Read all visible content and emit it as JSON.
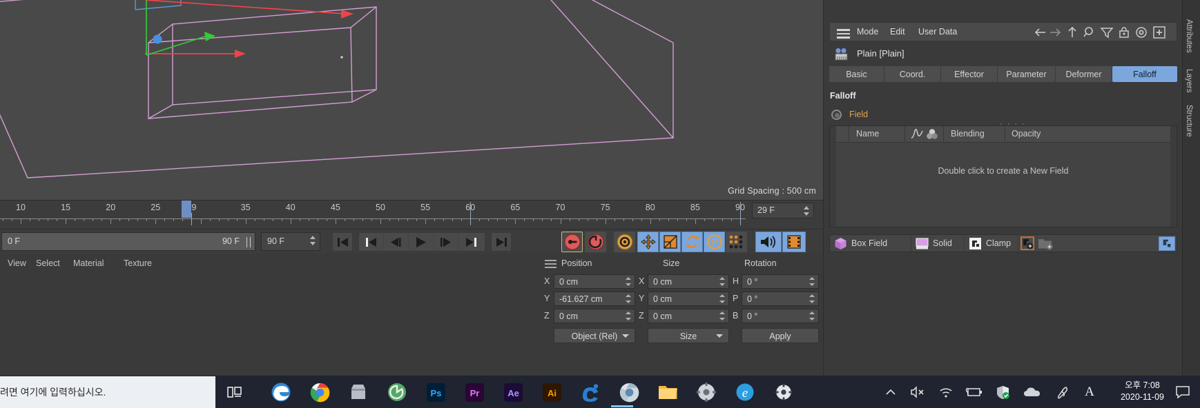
{
  "viewport": {
    "grid_spacing": "Grid Spacing : 500 cm",
    "background": "#494949",
    "wire_color": "#d59fd5",
    "axis_x_color": "#f0444a",
    "axis_y_color": "#38c838",
    "axis_z_color": "#4a90e2"
  },
  "timeline": {
    "labels": [
      "10",
      "15",
      "20",
      "25",
      "29",
      "35",
      "40",
      "45",
      "50",
      "55",
      "60",
      "65",
      "70",
      "75",
      "80",
      "85",
      "90"
    ],
    "playhead_frame": "29",
    "frame_field": "29 F"
  },
  "transport": {
    "range_start": "0 F",
    "range_end": "90 F",
    "end_field": "90 F",
    "buttons": [
      {
        "name": "go-to-start-button",
        "icon": "skip-start"
      },
      {
        "name": "previous-key-button",
        "icon": "prev-key"
      },
      {
        "name": "previous-frame-button",
        "icon": "step-back"
      },
      {
        "name": "play-button",
        "icon": "play"
      },
      {
        "name": "next-frame-button",
        "icon": "step-forward"
      },
      {
        "name": "next-key-button",
        "icon": "next-key"
      },
      {
        "name": "go-to-end-button",
        "icon": "skip-end"
      }
    ],
    "toggles": [
      {
        "name": "record-active-objects-button",
        "icon": "record-key",
        "color": "#e05a5a"
      },
      {
        "name": "autokeying-button",
        "icon": "auto-key",
        "color": "#e05a5a"
      },
      {
        "name": "keyframe-settings-button",
        "icon": "gear",
        "color": "#e0a040"
      },
      {
        "name": "position-key-button",
        "icon": "move",
        "color": "#e08a30"
      },
      {
        "name": "scale-key-button",
        "icon": "scale",
        "color": "#e08a30"
      },
      {
        "name": "rotation-key-button",
        "icon": "rotate",
        "color": "#e08a30"
      },
      {
        "name": "parameter-key-button",
        "icon": "param-p",
        "color": "#e0a040"
      },
      {
        "name": "point-level-animation-button",
        "icon": "dots-grid",
        "color": "#e08a30"
      },
      {
        "name": "sound-button",
        "icon": "speaker",
        "color": "#1a1a1a"
      },
      {
        "name": "frames-button",
        "icon": "film",
        "color": "#e08a30"
      }
    ]
  },
  "view_menu": {
    "items": [
      "View",
      "Select",
      "Material",
      "Texture"
    ]
  },
  "coord_panel": {
    "columns": [
      "Position",
      "Size",
      "Rotation"
    ],
    "rows": [
      {
        "labels": [
          "X",
          "X",
          "H"
        ],
        "values": [
          "0 cm",
          "0 cm",
          "0 °"
        ]
      },
      {
        "labels": [
          "Y",
          "Y",
          "P"
        ],
        "values": [
          "-61.627 cm",
          "0 cm",
          "0 °"
        ]
      },
      {
        "labels": [
          "Z",
          "Z",
          "B"
        ],
        "values": [
          "0 cm",
          "0 cm",
          "0 °"
        ]
      }
    ],
    "mode_dropdown": "Object (Rel)",
    "size_dropdown": "Size",
    "apply_label": "Apply"
  },
  "attributes": {
    "menus": [
      "Mode",
      "Edit",
      "User Data"
    ],
    "toolbar_icons": [
      {
        "name": "back-arrow-icon",
        "glyph": "←"
      },
      {
        "name": "forward-arrow-icon",
        "glyph": "→"
      },
      {
        "name": "up-arrow-icon",
        "glyph": "↑"
      },
      {
        "name": "search-icon",
        "glyph": "search"
      },
      {
        "name": "filter-icon",
        "glyph": "funnel"
      },
      {
        "name": "lock-icon",
        "glyph": "lock"
      },
      {
        "name": "target-icon",
        "glyph": "circle"
      },
      {
        "name": "add-icon",
        "glyph": "plus-box"
      }
    ],
    "object_name": "Plain [Plain]",
    "tabs": [
      {
        "label": "Basic",
        "active": false
      },
      {
        "label": "Coord.",
        "active": false
      },
      {
        "label": "Effector",
        "active": false
      },
      {
        "label": "Parameter",
        "active": false
      },
      {
        "label": "Deformer",
        "active": false
      },
      {
        "label": "Falloff",
        "active": true
      }
    ],
    "section_title": "Falloff",
    "field_label": "Field",
    "table_headers": [
      "Name",
      "Blending",
      "Opacity"
    ],
    "empty_message": "Double click to create a New Field",
    "bottom_bar": [
      {
        "label": "Box Field",
        "icon": "cube-icon",
        "color": "#c87fd8"
      },
      {
        "label": "Solid",
        "icon": "monitor-icon",
        "color": "#c87fd8"
      },
      {
        "label": "Clamp",
        "icon": "clamp-icon",
        "color": "#e8e8e8"
      }
    ],
    "active_tab_color": "#7ba7dd"
  },
  "dock": {
    "labels": [
      "Attributes",
      "Layers",
      "Structure"
    ]
  },
  "taskbar": {
    "search_placeholder": "려면 여기에 입력하십시오.",
    "apps": [
      {
        "name": "task-view-icon",
        "label": "Task View"
      },
      {
        "name": "edge-legacy-icon",
        "label": "Microsoft Edge"
      },
      {
        "name": "chrome-icon",
        "label": "Google Chrome"
      },
      {
        "name": "store-icon",
        "label": "Microsoft Store"
      },
      {
        "name": "app-green-icon",
        "label": "App"
      },
      {
        "name": "photoshop-icon",
        "label": "Ps"
      },
      {
        "name": "premiere-icon",
        "label": "Pr"
      },
      {
        "name": "aftereffects-icon",
        "label": "Ae"
      },
      {
        "name": "illustrator-icon",
        "label": "Ai"
      },
      {
        "name": "cinema4d-icon",
        "label": "C4D"
      },
      {
        "name": "chrome-active-icon",
        "label": "Chrome"
      },
      {
        "name": "explorer-icon",
        "label": "File Explorer"
      },
      {
        "name": "settings-gear-icon",
        "label": "Settings"
      },
      {
        "name": "ie-icon",
        "label": "Internet Explorer"
      },
      {
        "name": "settings2-icon",
        "label": "Settings"
      }
    ],
    "tray": [
      {
        "name": "show-hidden-icons-chevron",
        "glyph": "^"
      },
      {
        "name": "volume-muted-icon",
        "glyph": "mute"
      },
      {
        "name": "wifi-icon",
        "glyph": "wifi"
      },
      {
        "name": "battery-charging-icon",
        "glyph": "battery"
      },
      {
        "name": "security-shield-icon",
        "glyph": "shield"
      },
      {
        "name": "onedrive-icon",
        "glyph": "cloud"
      },
      {
        "name": "pen-workspace-icon",
        "glyph": "pen"
      },
      {
        "name": "ime-indicator",
        "glyph": "A"
      }
    ],
    "time": "오후 7:08",
    "date": "2020-11-09"
  }
}
